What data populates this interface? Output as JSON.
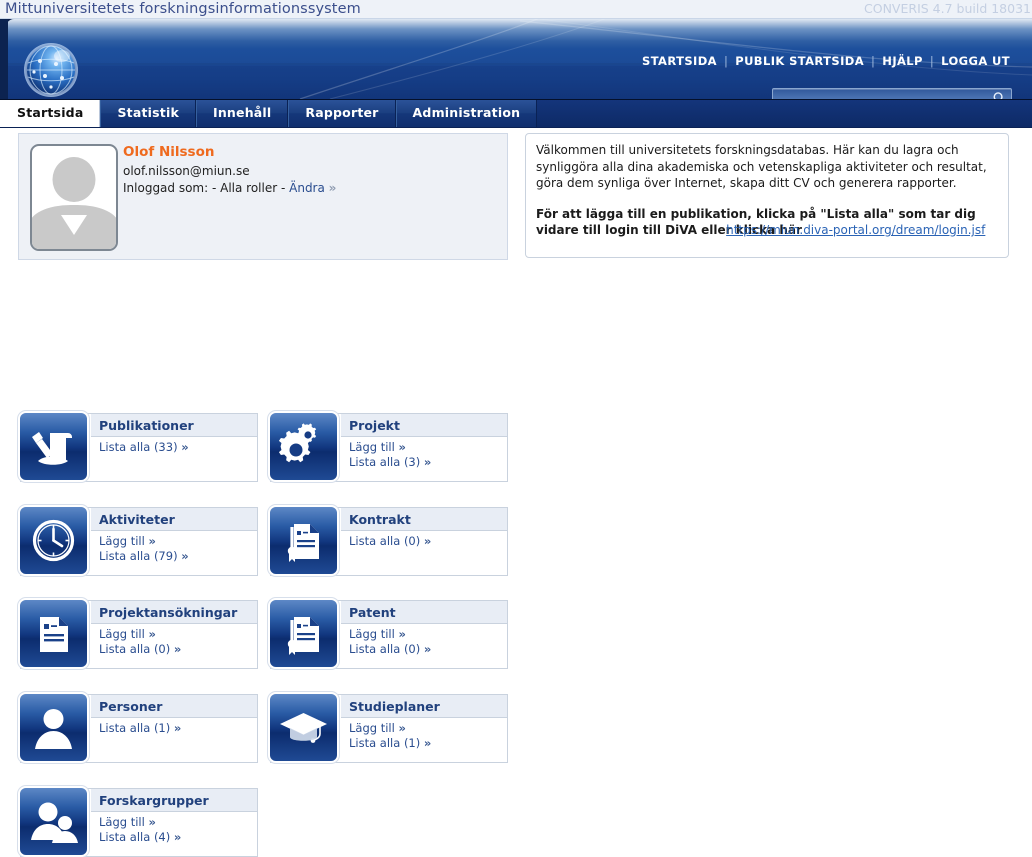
{
  "topstrip": {
    "app_title": "Mittuniversitetets forskningsinformationssystem",
    "version": "CONVERIS 4.7 build 18031"
  },
  "banner": {
    "logo_icon": "globe-icon",
    "nav": [
      {
        "label": "STARTSIDA"
      },
      {
        "label": "PUBLIK STARTSIDA"
      },
      {
        "label": "HJÄLP"
      },
      {
        "label": "LOGGA UT"
      }
    ],
    "separator": "|",
    "search": {
      "value": "",
      "placeholder": "",
      "icon": "search-icon"
    }
  },
  "tabs": [
    {
      "label": "Startsida",
      "active": true
    },
    {
      "label": "Statistik",
      "active": false
    },
    {
      "label": "Innehåll",
      "active": false
    },
    {
      "label": "Rapporter",
      "active": false
    },
    {
      "label": "Administration",
      "active": false
    }
  ],
  "profile": {
    "avatar_icon": "user-placeholder-icon",
    "name": "Olof Nilsson",
    "email": "olof.nilsson@miun.se",
    "role_prefix": "Inloggad som: - Alla roller - ",
    "role_link": "Ändra",
    "chevron": "»"
  },
  "welcome": {
    "paragraph": "Välkommen till universitetets forskningsdatabas. Här kan du lagra och synliggöra alla dina akademiska och vetenskapliga aktiviteter och resultat, göra dem synliga över Internet, skapa ditt CV och generera rapporter.",
    "bold_text": "För att lägga till en publikation, klicka på \"Lista alla\" som tar dig vidare till login till DiVA eller klicka här",
    "url": "https://miun.diva-portal.org/dream/login.jsf"
  },
  "tiles": [
    {
      "title": "Publikationer",
      "icon": "publication-icon",
      "links": [
        {
          "label": "Lista alla (33)",
          "chevron": "»"
        }
      ],
      "col": 0,
      "row": 0
    },
    {
      "title": "Projekt",
      "icon": "gears-icon",
      "links": [
        {
          "label": "Lägg till",
          "chevron": "»"
        },
        {
          "label": "Lista alla (3)",
          "chevron": "»"
        }
      ],
      "col": 1,
      "row": 0
    },
    {
      "title": "Aktiviteter",
      "icon": "clock-icon",
      "links": [
        {
          "label": "Lägg till",
          "chevron": "»"
        },
        {
          "label": "Lista alla (79)",
          "chevron": "»"
        }
      ],
      "col": 0,
      "row": 1
    },
    {
      "title": "Kontrakt",
      "icon": "contract-icon",
      "links": [
        {
          "label": "Lista alla (0)",
          "chevron": "»"
        }
      ],
      "col": 1,
      "row": 1
    },
    {
      "title": "Projektansökningar",
      "icon": "document-icon",
      "links": [
        {
          "label": "Lägg till",
          "chevron": "»"
        },
        {
          "label": "Lista alla (0)",
          "chevron": "»"
        }
      ],
      "col": 0,
      "row": 2
    },
    {
      "title": "Patent",
      "icon": "patent-icon",
      "links": [
        {
          "label": "Lägg till",
          "chevron": "»"
        },
        {
          "label": "Lista alla (0)",
          "chevron": "»"
        }
      ],
      "col": 1,
      "row": 2
    },
    {
      "title": "Personer",
      "icon": "person-icon",
      "links": [
        {
          "label": "Lista alla (1)",
          "chevron": "»"
        }
      ],
      "col": 0,
      "row": 3
    },
    {
      "title": "Studieplaner",
      "icon": "graduation-cap-icon",
      "links": [
        {
          "label": "Lägg till",
          "chevron": "»"
        },
        {
          "label": "Lista alla (1)",
          "chevron": "»"
        }
      ],
      "col": 1,
      "row": 3
    },
    {
      "title": "Forskargrupper",
      "icon": "group-icon",
      "links": [
        {
          "label": "Lägg till",
          "chevron": "»"
        },
        {
          "label": "Lista alla (4)",
          "chevron": "»"
        }
      ],
      "col": 0,
      "row": 4
    }
  ],
  "colors": {
    "brand_blue": "#1b4a96",
    "tab_active_bg": "#ffffff",
    "accent_orange": "#ef6a1e",
    "link_blue": "#2a4d8f",
    "panel_bg": "#eef1f6",
    "tile_header_bg": "#e8edf5"
  }
}
